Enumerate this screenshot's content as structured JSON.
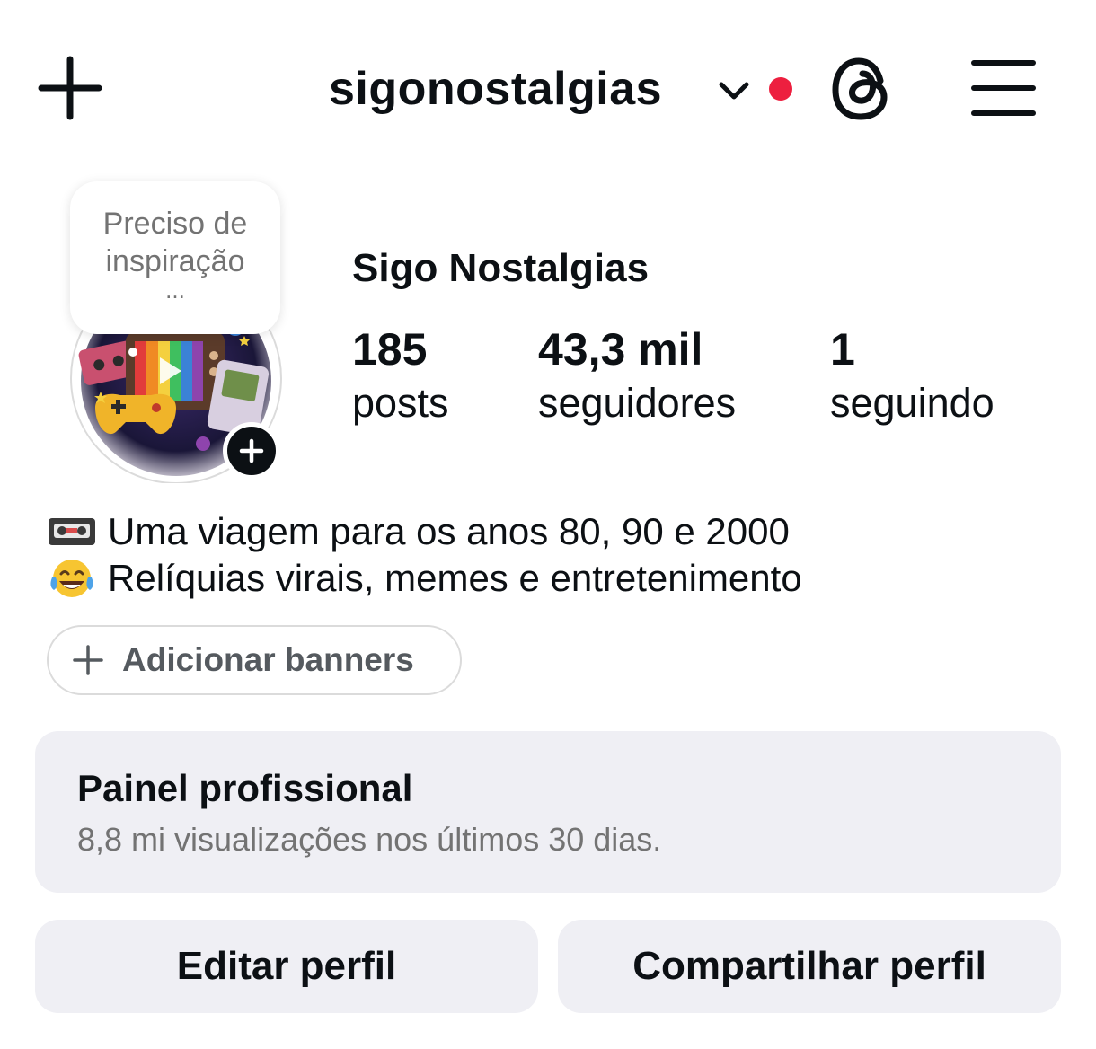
{
  "header": {
    "new_post_icon": "plus-icon",
    "username": "sigonostalgias",
    "account_switch_icon": "chevron-down-icon",
    "notification_dot_color": "#ed1f3f",
    "threads_icon": "threads-icon",
    "menu_icon": "hamburger-menu-icon"
  },
  "profile": {
    "note": {
      "line1": "Preciso de",
      "line2": "inspiração",
      "ellipsis": "..."
    },
    "avatar_icon": "retro-tv-games-avatar",
    "add_story_icon": "plus-icon",
    "display_name": "Sigo Nostalgias",
    "stats": [
      {
        "value": "185",
        "label": "posts"
      },
      {
        "value": "43,3 mil",
        "label": "seguidores"
      },
      {
        "value": "1",
        "label": "seguindo"
      }
    ]
  },
  "bio": [
    {
      "emoji": "videocassette-icon",
      "text": "Uma viagem para os anos 80, 90 e 2000"
    },
    {
      "emoji": "tears-of-joy-icon",
      "text": "Relíquias virais, memes e entretenimento"
    }
  ],
  "banners": {
    "icon": "plus-icon",
    "label": "Adicionar banners"
  },
  "professional_panel": {
    "title": "Painel profissional",
    "subtitle": "8,8 mi visualizações nos últimos 30 dias."
  },
  "actions": {
    "edit_label": "Editar perfil",
    "share_label": "Compartilhar perfil"
  }
}
